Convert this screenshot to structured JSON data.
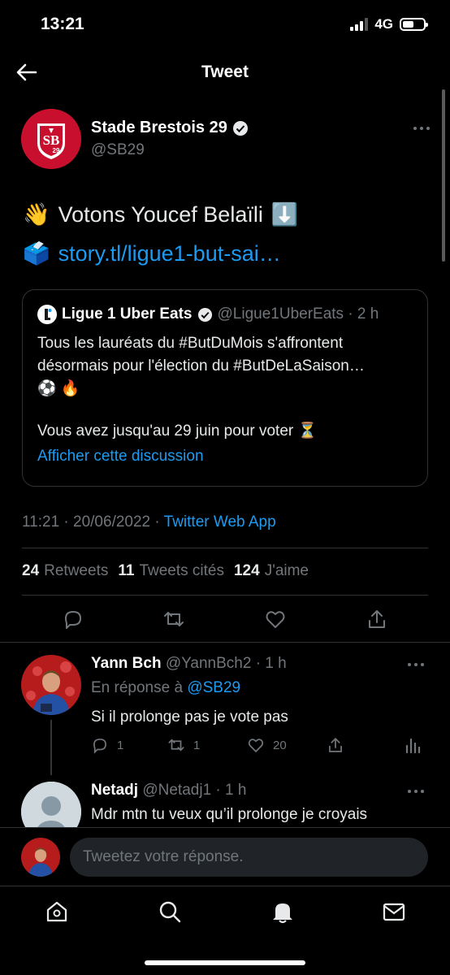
{
  "status_bar": {
    "time": "13:21",
    "network": "4G"
  },
  "header": {
    "title": "Tweet"
  },
  "tweet": {
    "author_name": "Stade Brestois 29",
    "author_handle": "@SB29",
    "line1_text": "Votons Youcef Belaïli",
    "line1_emoji": "👋",
    "line1_arrow": "⬇️",
    "line2_emoji": "🗳️",
    "link": "story.tl/ligue1-but-sai…",
    "timestamp": "11:21 · 20/06/2022 · ",
    "source_app": "Twitter Web App"
  },
  "quote": {
    "name": "Ligue 1 Uber Eats",
    "handle_time": "@Ligue1UberEats · 2 h",
    "text_line1": "Tous les lauréats du #ButDuMois s'affrontent",
    "text_line2": "désormais pour l'élection du #ButDeLaSaison…",
    "text_line3": "⚽ 🔥",
    "text_line4": "Vous avez jusqu'au 29 juin pour voter ⏳",
    "show_thread": "Afficher cette discussion"
  },
  "stats": {
    "retweets_count": "24",
    "retweets_label": "Retweets",
    "quotes_count": "11",
    "quotes_label": "Tweets cités",
    "likes_count": "124",
    "likes_label": "J'aime"
  },
  "replies": [
    {
      "name": "Yann Bch",
      "handle_time": "@YannBch2 · 1 h",
      "reply_to_prefix": "En réponse à ",
      "reply_to_handle": "@SB29",
      "text": "Si il prolonge pas je vote pas",
      "reply_count": "1",
      "retweet_count": "1",
      "like_count": "20"
    },
    {
      "name": "Netadj",
      "handle_time": "@Netadj1 · 1 h",
      "text": "Mdr mtn tu veux qu’il prolonge je croyais"
    }
  ],
  "composer": {
    "placeholder": "Tweetez votre réponse."
  },
  "colors": {
    "accent": "#1d9bf0",
    "background": "#000000",
    "muted": "#71767b",
    "club_red": "#c8102e"
  }
}
